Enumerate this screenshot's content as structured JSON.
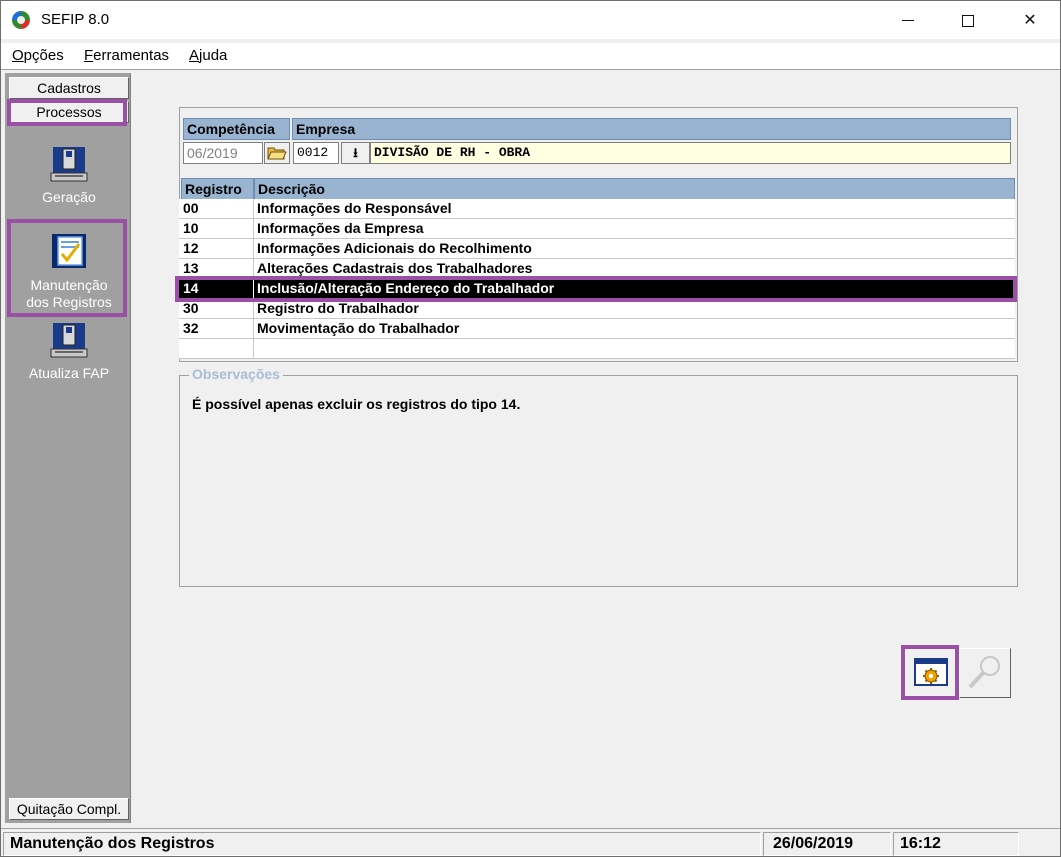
{
  "window": {
    "title": "SEFIP 8.0",
    "icons": {
      "app": "sefip-app-icon",
      "minimize": "minimize-icon",
      "maximize": "maximize-icon",
      "close": "close-icon"
    }
  },
  "menu": {
    "items": [
      {
        "mnemonic": "O",
        "rest": "pções"
      },
      {
        "mnemonic": "F",
        "rest": "erramentas"
      },
      {
        "mnemonic": "A",
        "rest": "juda"
      }
    ]
  },
  "sidebar": {
    "tabs": {
      "cadastros": "Cadastros",
      "processos": "Processos",
      "quitacao": "Quitação Compl."
    },
    "items": [
      {
        "label": "Geração",
        "icon": "computer-disk-icon"
      },
      {
        "label_line1": "Manutenção",
        "label_line2": "dos Registros",
        "icon": "checklist-icon"
      },
      {
        "label": "Atualiza FAP",
        "icon": "computer-disk-icon"
      }
    ]
  },
  "form": {
    "competencia_header": "Competência",
    "empresa_header": "Empresa",
    "competencia_value": "06/2019",
    "empresa_code": "0012",
    "empresa_name": "DIVISÃO DE RH - OBRA",
    "open_icon": "folder-open-icon",
    "download_icon": "download-arrow-icon"
  },
  "table": {
    "columns": [
      "Registro",
      "Descrição"
    ],
    "rows": [
      {
        "code": "00",
        "desc": "Informações do Responsável"
      },
      {
        "code": "10",
        "desc": "Informações da Empresa"
      },
      {
        "code": "12",
        "desc": "Informações Adicionais do Recolhimento"
      },
      {
        "code": "13",
        "desc": "Alterações Cadastrais dos Trabalhadores"
      },
      {
        "code": "14",
        "desc": "Inclusão/Alteração Endereço do Trabalhador"
      },
      {
        "code": "30",
        "desc": "Registro do Trabalhador"
      },
      {
        "code": "32",
        "desc": "Movimentação do Trabalhador"
      }
    ],
    "selected_code": "14"
  },
  "observacoes": {
    "title": "Observações",
    "text": "É possível  apenas excluir os registros do tipo 14."
  },
  "actions": {
    "execute_icon": "gear-window-icon",
    "search_icon": "magnifier-icon"
  },
  "status": {
    "message": "Manutenção dos Registros",
    "date": "26/06/2019",
    "time": "16:12"
  },
  "colors": {
    "highlight": "#9c4fa6",
    "header_blue": "#99b4d1",
    "selected_row": "#000000",
    "panel_gray": "#a0a0a0"
  }
}
